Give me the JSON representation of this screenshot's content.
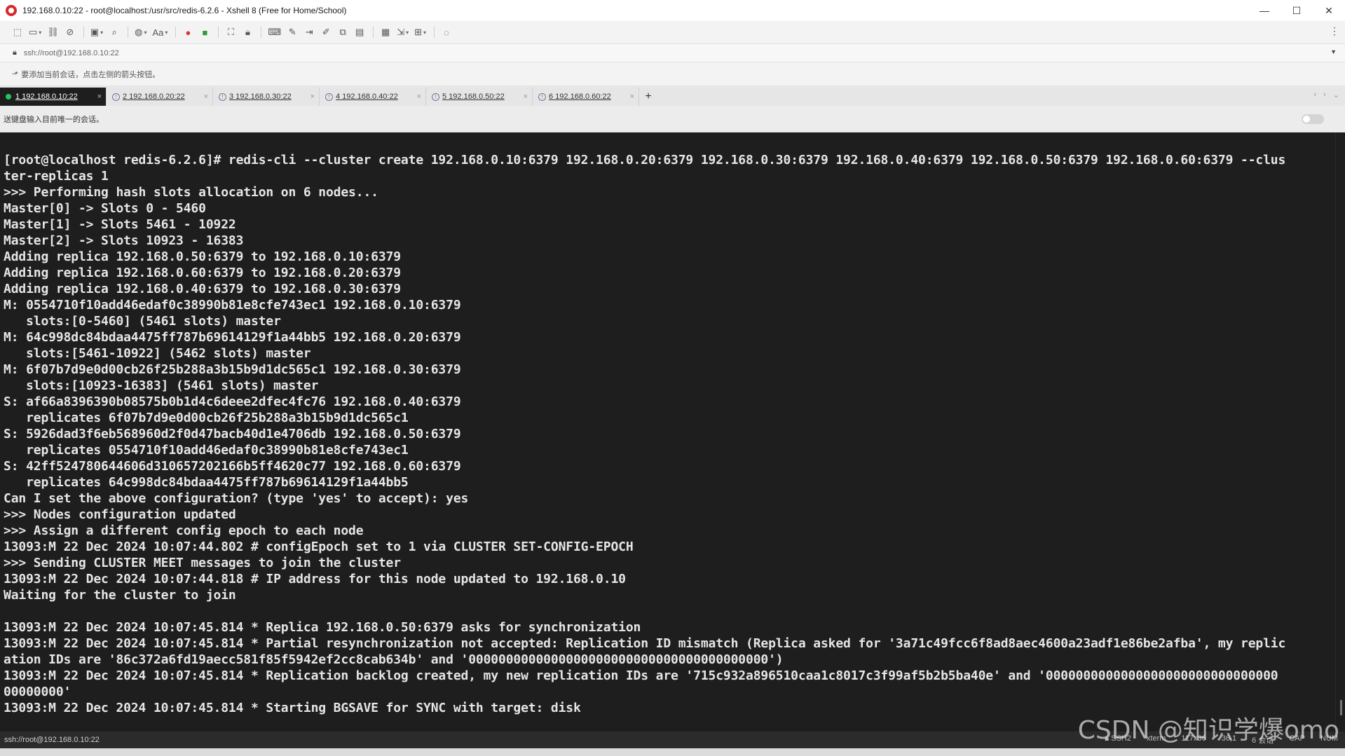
{
  "window": {
    "title": "192.168.0.10:22 - root@localhost:/usr/src/redis-6.2.6 - Xshell 8 (Free for Home/School)",
    "controls": [
      "—",
      "☐",
      "✕"
    ]
  },
  "toolbar": {
    "buttons": [
      {
        "name": "new-session-icon",
        "glyph": "⬚",
        "caret": false
      },
      {
        "name": "open-session-icon",
        "glyph": "▭",
        "caret": true
      },
      {
        "name": "reconnect-icon",
        "glyph": "⛓",
        "caret": false
      },
      {
        "name": "disconnect-icon",
        "glyph": "⊘",
        "caret": false
      },
      {
        "name": "new-tab-icon",
        "glyph": "▣",
        "caret": true
      },
      {
        "name": "find-icon",
        "glyph": "⌕",
        "caret": false
      },
      {
        "name": "globe-icon",
        "glyph": "◍",
        "caret": true
      },
      {
        "name": "font-icon",
        "glyph": "Aa",
        "caret": true
      },
      {
        "name": "xshell-icon",
        "glyph": "●",
        "caret": false,
        "accent": "red"
      },
      {
        "name": "xftp-icon",
        "glyph": "■",
        "caret": false,
        "accent": "green"
      },
      {
        "name": "fullscreen-icon",
        "glyph": "⛶",
        "caret": false
      },
      {
        "name": "lock-icon",
        "glyph": "🔒︎",
        "caret": false
      },
      {
        "name": "keyboard-icon",
        "glyph": "⌨",
        "caret": false
      },
      {
        "name": "highlight-icon",
        "glyph": "✎",
        "caret": false
      },
      {
        "name": "send-icon",
        "glyph": "⇥",
        "caret": false
      },
      {
        "name": "script-icon",
        "glyph": "✐",
        "caret": false
      },
      {
        "name": "compose-icon",
        "glyph": "⧉",
        "caret": false
      },
      {
        "name": "tile-icon",
        "glyph": "▤",
        "caret": false
      },
      {
        "name": "tunnel-icon",
        "glyph": "▦",
        "caret": false
      },
      {
        "name": "transfer-icon",
        "glyph": "⇲",
        "caret": true
      },
      {
        "name": "layout-icon",
        "glyph": "⊞",
        "caret": true
      },
      {
        "name": "help-icon",
        "glyph": "◌",
        "caret": false
      }
    ],
    "more": "⋮"
  },
  "address": {
    "value": "ssh://root@192.168.0.10:22"
  },
  "hint": {
    "text": "要添加当前会话，点击左侧的箭头按钮。"
  },
  "tabs": [
    {
      "label": "1 192.168.0.10:22",
      "active": true
    },
    {
      "label": "2 192.168.0.20:22",
      "active": false
    },
    {
      "label": "3 192.168.0.30:22",
      "active": false
    },
    {
      "label": "4 192.168.0.40:22",
      "active": false
    },
    {
      "label": "5 192.168.0.50:22",
      "active": false
    },
    {
      "label": "6 192.168.0.60:22",
      "active": false
    }
  ],
  "send_bar": {
    "text": "送键盘输入目前唯一的会话。"
  },
  "terminal": {
    "lines": [
      "[root@localhost redis-6.2.6]# redis-cli --cluster create 192.168.0.10:6379 192.168.0.20:6379 192.168.0.30:6379 192.168.0.40:6379 192.168.0.50:6379 192.168.0.60:6379 --clus",
      "ter-replicas 1",
      ">>> Performing hash slots allocation on 6 nodes...",
      "Master[0] -> Slots 0 - 5460",
      "Master[1] -> Slots 5461 - 10922",
      "Master[2] -> Slots 10923 - 16383",
      "Adding replica 192.168.0.50:6379 to 192.168.0.10:6379",
      "Adding replica 192.168.0.60:6379 to 192.168.0.20:6379",
      "Adding replica 192.168.0.40:6379 to 192.168.0.30:6379",
      "M: 0554710f10add46edaf0c38990b81e8cfe743ec1 192.168.0.10:6379",
      "   slots:[0-5460] (5461 slots) master",
      "M: 64c998dc84bdaa4475ff787b69614129f1a44bb5 192.168.0.20:6379",
      "   slots:[5461-10922] (5462 slots) master",
      "M: 6f07b7d9e0d00cb26f25b288a3b15b9d1dc565c1 192.168.0.30:6379",
      "   slots:[10923-16383] (5461 slots) master",
      "S: af66a8396390b08575b0b1d4c6deee2dfec4fc76 192.168.0.40:6379",
      "   replicates 6f07b7d9e0d00cb26f25b288a3b15b9d1dc565c1",
      "S: 5926dad3f6eb568960d2f0d47bacb40d1e4706db 192.168.0.50:6379",
      "   replicates 0554710f10add46edaf0c38990b81e8cfe743ec1",
      "S: 42ff524780644606d310657202166b5ff4620c77 192.168.0.60:6379",
      "   replicates 64c998dc84bdaa4475ff787b69614129f1a44bb5",
      "Can I set the above configuration? (type 'yes' to accept): yes",
      ">>> Nodes configuration updated",
      ">>> Assign a different config epoch to each node",
      "13093:M 22 Dec 2024 10:07:44.802 # configEpoch set to 1 via CLUSTER SET-CONFIG-EPOCH",
      ">>> Sending CLUSTER MEET messages to join the cluster",
      "13093:M 22 Dec 2024 10:07:44.818 # IP address for this node updated to 192.168.0.10",
      "Waiting for the cluster to join",
      "",
      "13093:M 22 Dec 2024 10:07:45.814 * Replica 192.168.0.50:6379 asks for synchronization",
      "13093:M 22 Dec 2024 10:07:45.814 * Partial resynchronization not accepted: Replication ID mismatch (Replica asked for '3a71c49fcc6f8ad8aec4600a23adf1e86be2afba', my replic",
      "ation IDs are '86c372a6fd19aecc581f85f5942ef2cc8cab634b' and '0000000000000000000000000000000000000000')",
      "13093:M 22 Dec 2024 10:07:45.814 * Replication backlog created, my new replication IDs are '715c932a896510caa1c8017c3f99af5b2b5ba40e' and '0000000000000000000000000000000",
      "00000000'",
      "13093:M 22 Dec 2024 10:07:45.814 * Starting BGSAVE for SYNC with target: disk"
    ]
  },
  "status": {
    "left": "ssh://root@192.168.0.10:22",
    "protocol": "SSH2",
    "term": "xterm",
    "size": "117x36",
    "pos": "36,1",
    "sessions": "6 会话",
    "caps": "CAP",
    "num": "NUM"
  },
  "watermark": "CSDN @知识学爆omo"
}
